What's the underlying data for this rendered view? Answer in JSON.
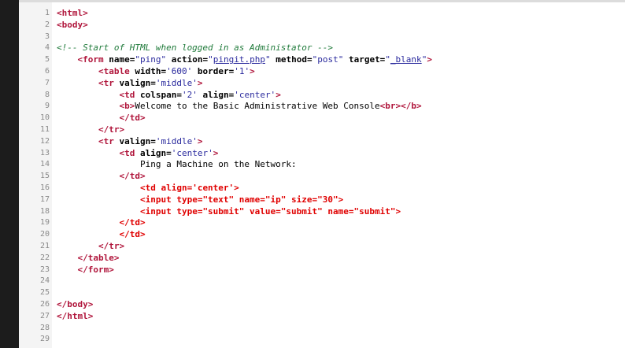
{
  "lines": [
    {
      "n": "1",
      "tokens": [
        {
          "t": "tag",
          "v": "<html>"
        }
      ]
    },
    {
      "n": "2",
      "tokens": [
        {
          "t": "tag",
          "v": "<body>"
        }
      ]
    },
    {
      "n": "3",
      "tokens": []
    },
    {
      "n": "4",
      "tokens": [
        {
          "t": "comment",
          "v": "<!-- Start of HTML when logged in as Administator -->"
        }
      ]
    },
    {
      "n": "5",
      "tokens": [
        {
          "t": "ws",
          "v": "    "
        },
        {
          "t": "tag",
          "v": "<form "
        },
        {
          "t": "attr",
          "v": "name="
        },
        {
          "t": "val",
          "v": "\"ping\""
        },
        {
          "t": "attr",
          "v": " action="
        },
        {
          "t": "val",
          "v": "\""
        },
        {
          "t": "valu",
          "v": "pingit.php"
        },
        {
          "t": "val",
          "v": "\""
        },
        {
          "t": "attr",
          "v": " method="
        },
        {
          "t": "val",
          "v": "\"post\""
        },
        {
          "t": "attr",
          "v": " target="
        },
        {
          "t": "val",
          "v": "\""
        },
        {
          "t": "valu",
          "v": "_blank"
        },
        {
          "t": "val",
          "v": "\""
        },
        {
          "t": "tag",
          "v": ">"
        }
      ]
    },
    {
      "n": "6",
      "tokens": [
        {
          "t": "ws",
          "v": "        "
        },
        {
          "t": "tag",
          "v": "<table "
        },
        {
          "t": "attr",
          "v": "width="
        },
        {
          "t": "val",
          "v": "'600'"
        },
        {
          "t": "attr",
          "v": " border="
        },
        {
          "t": "val",
          "v": "'1'"
        },
        {
          "t": "tag",
          "v": ">"
        }
      ]
    },
    {
      "n": "7",
      "tokens": [
        {
          "t": "ws",
          "v": "        "
        },
        {
          "t": "tag",
          "v": "<tr "
        },
        {
          "t": "attr",
          "v": "valign="
        },
        {
          "t": "val",
          "v": "'middle'"
        },
        {
          "t": "tag",
          "v": ">"
        }
      ]
    },
    {
      "n": "8",
      "tokens": [
        {
          "t": "ws",
          "v": "            "
        },
        {
          "t": "tag",
          "v": "<td "
        },
        {
          "t": "attr",
          "v": "colspan="
        },
        {
          "t": "val",
          "v": "'2'"
        },
        {
          "t": "attr",
          "v": " align="
        },
        {
          "t": "val",
          "v": "'center'"
        },
        {
          "t": "tag",
          "v": ">"
        }
      ]
    },
    {
      "n": "9",
      "tokens": [
        {
          "t": "ws",
          "v": "            "
        },
        {
          "t": "tag",
          "v": "<b>"
        },
        {
          "t": "text",
          "v": "Welcome to the Basic Administrative Web Console"
        },
        {
          "t": "tag",
          "v": "<br></b>"
        }
      ]
    },
    {
      "n": "10",
      "tokens": [
        {
          "t": "ws",
          "v": "            "
        },
        {
          "t": "tag",
          "v": "</td>"
        }
      ]
    },
    {
      "n": "11",
      "tokens": [
        {
          "t": "ws",
          "v": "        "
        },
        {
          "t": "tag",
          "v": "</tr>"
        }
      ]
    },
    {
      "n": "12",
      "tokens": [
        {
          "t": "ws",
          "v": "        "
        },
        {
          "t": "tag",
          "v": "<tr "
        },
        {
          "t": "attr",
          "v": "valign="
        },
        {
          "t": "val",
          "v": "'middle'"
        },
        {
          "t": "tag",
          "v": ">"
        }
      ]
    },
    {
      "n": "13",
      "tokens": [
        {
          "t": "ws",
          "v": "            "
        },
        {
          "t": "tag",
          "v": "<td "
        },
        {
          "t": "attr",
          "v": "align="
        },
        {
          "t": "val",
          "v": "'center'"
        },
        {
          "t": "tag",
          "v": ">"
        }
      ]
    },
    {
      "n": "14",
      "tokens": [
        {
          "t": "ws",
          "v": "                "
        },
        {
          "t": "text",
          "v": "Ping a Machine on the Network:"
        }
      ]
    },
    {
      "n": "15",
      "tokens": [
        {
          "t": "ws",
          "v": "            "
        },
        {
          "t": "tag",
          "v": "</td>"
        }
      ]
    },
    {
      "n": "16",
      "tokens": [
        {
          "t": "ws",
          "v": "                "
        },
        {
          "t": "red",
          "v": "<td align='center'>"
        }
      ]
    },
    {
      "n": "17",
      "tokens": [
        {
          "t": "ws",
          "v": "                "
        },
        {
          "t": "red",
          "v": "<input type=\"text\" name=\"ip\" size=\"30\">"
        }
      ]
    },
    {
      "n": "18",
      "tokens": [
        {
          "t": "ws",
          "v": "                "
        },
        {
          "t": "red",
          "v": "<input type=\"submit\" value=\"submit\" name=\"submit\">"
        }
      ]
    },
    {
      "n": "19",
      "tokens": [
        {
          "t": "ws",
          "v": "            "
        },
        {
          "t": "red",
          "v": "</td>"
        }
      ]
    },
    {
      "n": "20",
      "tokens": [
        {
          "t": "ws",
          "v": "            "
        },
        {
          "t": "red",
          "v": "</td>"
        }
      ]
    },
    {
      "n": "21",
      "tokens": [
        {
          "t": "ws",
          "v": "        "
        },
        {
          "t": "tag",
          "v": "</tr>"
        }
      ]
    },
    {
      "n": "22",
      "tokens": [
        {
          "t": "ws",
          "v": "    "
        },
        {
          "t": "tag",
          "v": "</table>"
        }
      ]
    },
    {
      "n": "23",
      "tokens": [
        {
          "t": "ws",
          "v": "    "
        },
        {
          "t": "tag",
          "v": "</form>"
        }
      ]
    },
    {
      "n": "24",
      "tokens": []
    },
    {
      "n": "25",
      "tokens": []
    },
    {
      "n": "26",
      "tokens": [
        {
          "t": "tag",
          "v": "</body>"
        }
      ]
    },
    {
      "n": "27",
      "tokens": [
        {
          "t": "tag",
          "v": "</html>"
        }
      ]
    },
    {
      "n": "28",
      "tokens": []
    },
    {
      "n": "29",
      "tokens": []
    }
  ],
  "colors": {
    "tag": "#b0153b",
    "comment": "#1f7a3a",
    "value": "#2b2b9e",
    "highlight_red": "#e00000",
    "line_number": "#8a8a8a"
  }
}
